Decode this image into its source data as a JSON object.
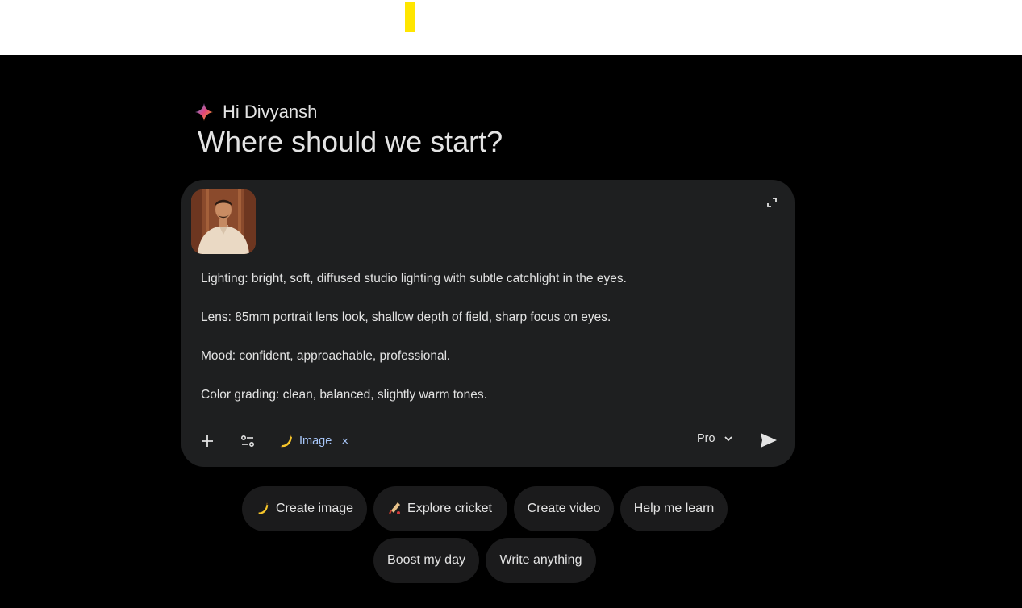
{
  "greeting": {
    "hello": "Hi Divyansh",
    "question": "Where should we start?"
  },
  "composer": {
    "attachment": {
      "icon": "portrait-thumbnail"
    },
    "prompt_lines": [
      "Lighting: bright, soft, diffused studio lighting with subtle catchlight in the eyes.",
      "Lens: 85mm portrait lens look, shallow depth of field, sharp focus on eyes.",
      "Mood: confident, approachable, professional.",
      "Color grading: clean, balanced, slightly warm tones."
    ],
    "tool_chip": {
      "label": "Image",
      "icon": "banana-icon",
      "close": "×"
    },
    "model": "Pro",
    "icons": [
      "plus-icon",
      "tools-icon",
      "expand-icon",
      "send-icon",
      "chevron-down-icon"
    ]
  },
  "suggestions": [
    {
      "label": "Create image",
      "icon": "banana-icon"
    },
    {
      "label": "Explore cricket",
      "icon": "cricket-bat-icon"
    },
    {
      "label": "Create video"
    },
    {
      "label": "Help me learn"
    },
    {
      "label": "Boost my day"
    },
    {
      "label": "Write anything"
    }
  ],
  "colors": {
    "background": "#000000",
    "card": "#1e1f20",
    "chip_accent": "#a8c7fa",
    "suggestion_bg": "#1b1b1c"
  }
}
